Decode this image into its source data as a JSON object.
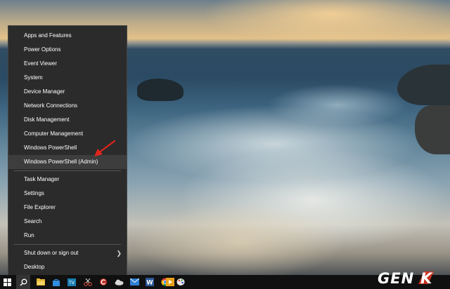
{
  "winx_menu": {
    "items": [
      {
        "label": "Apps and Features"
      },
      {
        "label": "Power Options"
      },
      {
        "label": "Event Viewer"
      },
      {
        "label": "System"
      },
      {
        "label": "Device Manager"
      },
      {
        "label": "Network Connections"
      },
      {
        "label": "Disk Management"
      },
      {
        "label": "Computer Management"
      },
      {
        "label": "Windows PowerShell"
      },
      {
        "label": "Windows PowerShell (Admin)"
      },
      {
        "label": "Task Manager"
      },
      {
        "label": "Settings"
      },
      {
        "label": "File Explorer"
      },
      {
        "label": "Search"
      },
      {
        "label": "Run"
      },
      {
        "label": "Shut down or sign out",
        "submenu": "chevron-right-icon"
      },
      {
        "label": "Desktop"
      }
    ],
    "highlighted_item": "Windows PowerShell (Admin)"
  },
  "taskbar": {
    "icons": [
      "windows-start-icon",
      "search-icon",
      "file-explorer-icon",
      "store-icon",
      "tv-app-icon",
      "snipping-tool-icon",
      "ccleaner-icon",
      "onedrive-icon",
      "mail-icon",
      "word-icon",
      "chrome-icon",
      "paint-icon",
      "media-player-icon"
    ]
  },
  "watermark": {
    "text": "GENK",
    "accent_color": "#d9321d"
  },
  "colors": {
    "menu_bg": "#2b2b2b",
    "menu_text": "#ffffff",
    "highlight": "#3d3d3d",
    "arrow": "#e0251b",
    "taskbar": "#101010"
  }
}
